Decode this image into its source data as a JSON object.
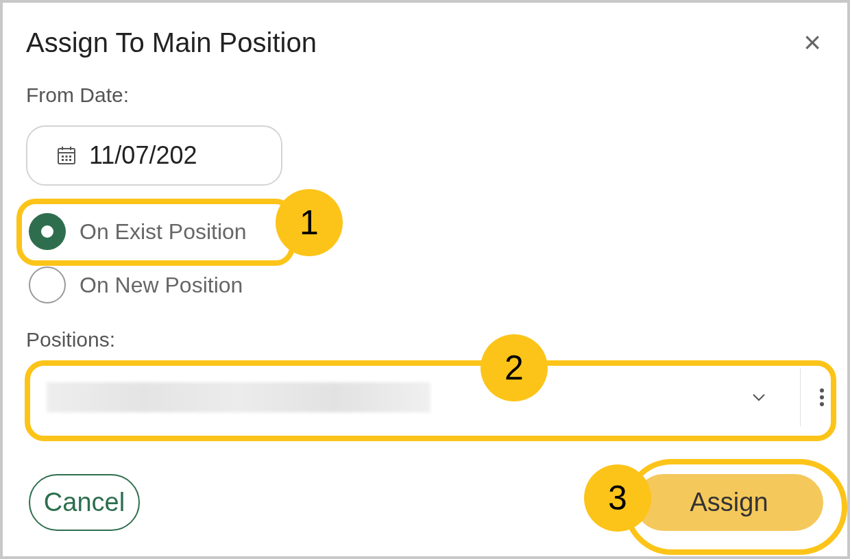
{
  "dialog": {
    "title": "Assign To Main Position",
    "close": "×"
  },
  "from_date": {
    "label": "From Date:",
    "value": "11/07/202"
  },
  "options": [
    {
      "label": "On Exist Position",
      "selected": true
    },
    {
      "label": "On New Position",
      "selected": false
    }
  ],
  "positions": {
    "label": "Positions:"
  },
  "buttons": [
    {
      "label": "Cancel",
      "kind": "secondary"
    },
    {
      "label": "Assign",
      "kind": "primary"
    }
  ],
  "callouts": [
    "1",
    "2",
    "3"
  ]
}
